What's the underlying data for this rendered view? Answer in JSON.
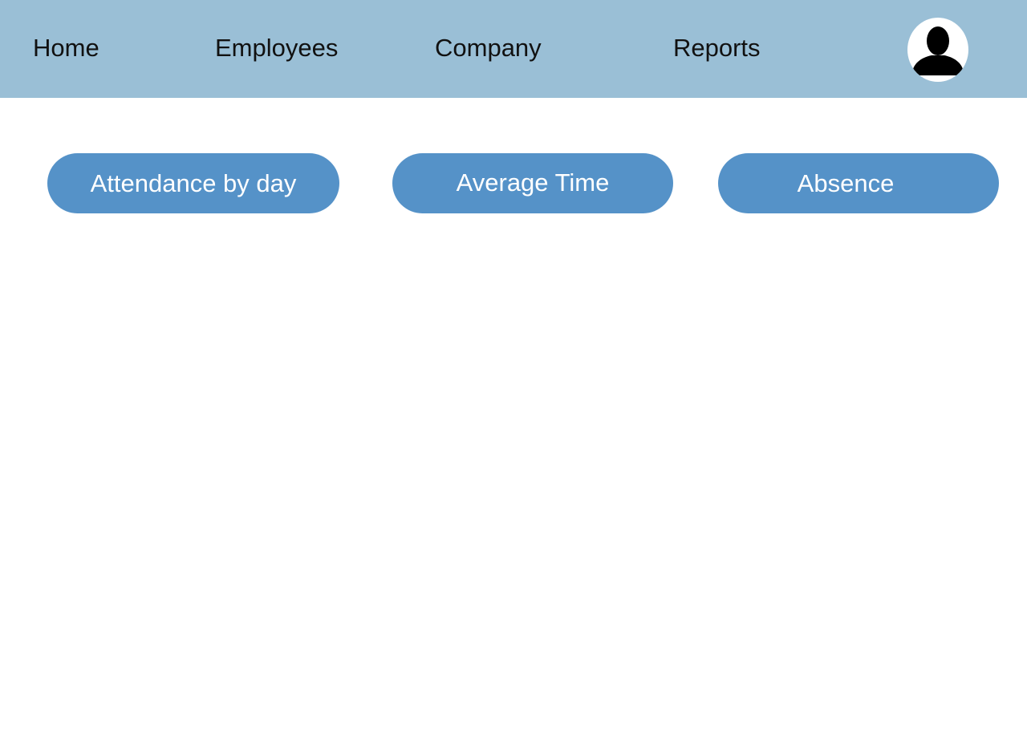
{
  "header": {
    "nav": {
      "home": "Home",
      "employees": "Employees",
      "company": "Company",
      "reports": "Reports"
    },
    "avatar_icon": "user-silhouette-icon",
    "background_color": "#9abfd6"
  },
  "actions": {
    "attendance_by_day": "Attendance by day",
    "average_time": "Average Time",
    "absence": "Absence",
    "button_color": "#5592c8"
  }
}
